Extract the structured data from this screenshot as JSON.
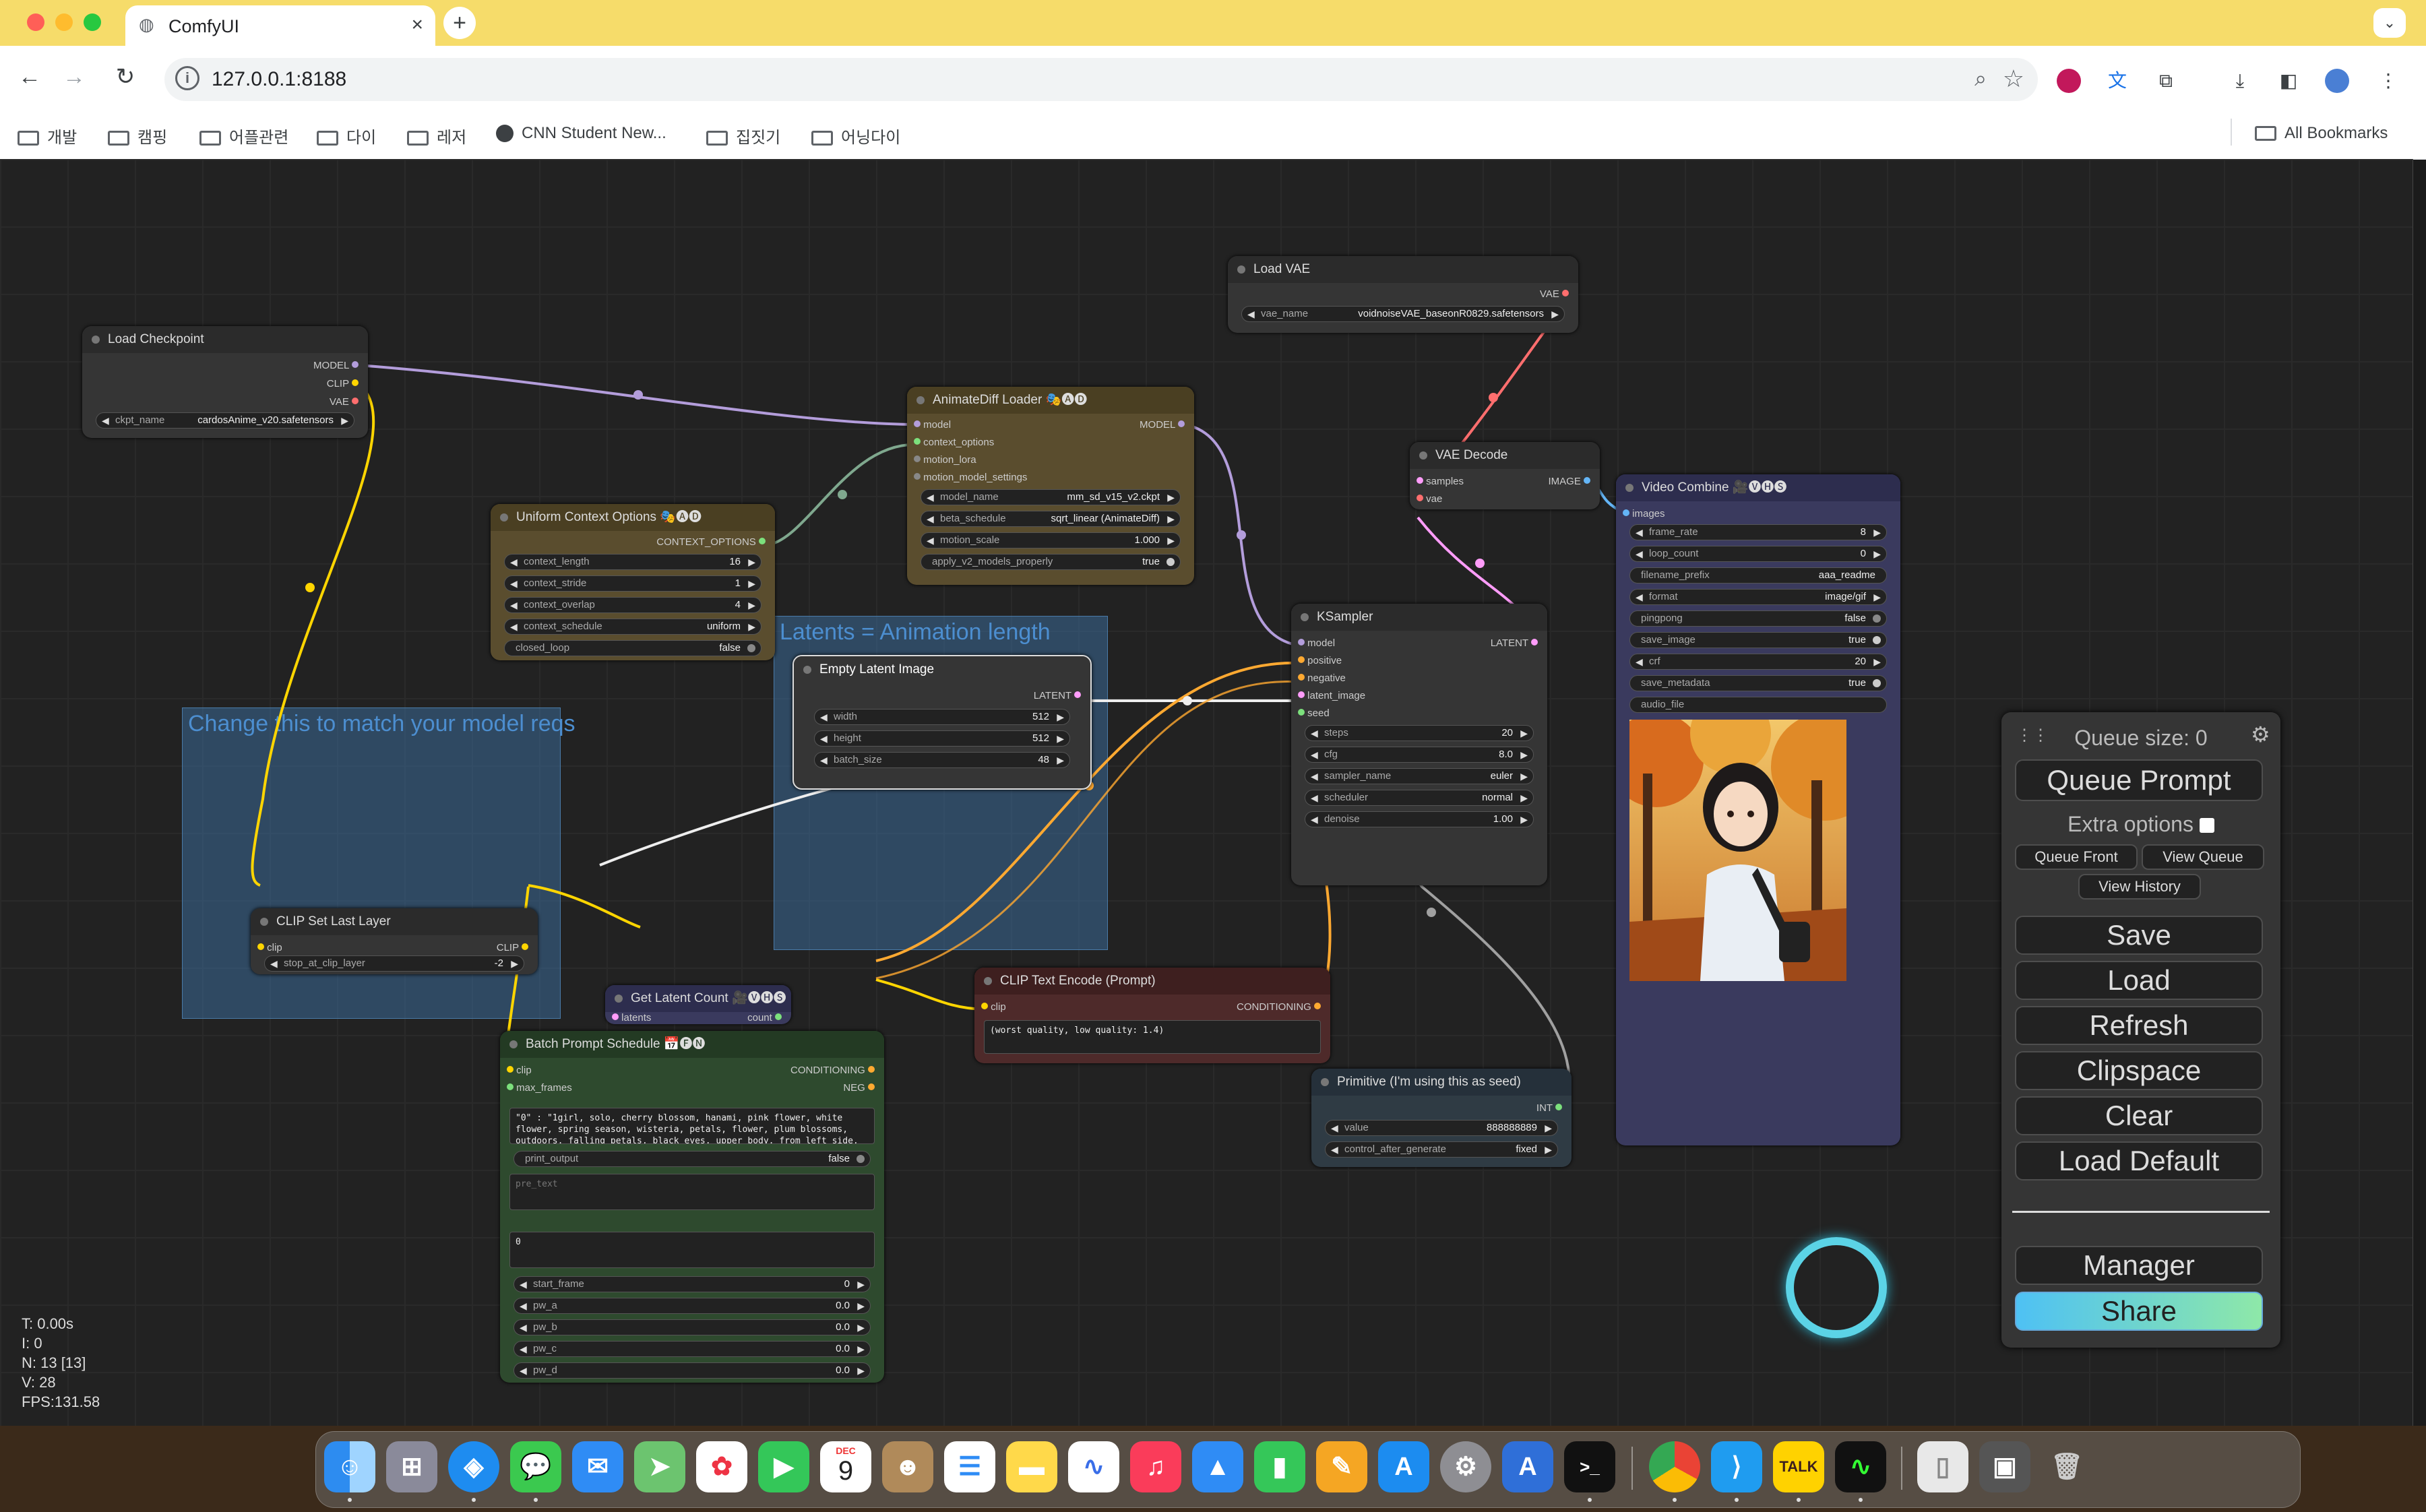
{
  "browser": {
    "tab_title": "ComfyUI",
    "url": "127.0.0.1:8188",
    "bookmarks": [
      "개발",
      "캠핑",
      "어플관련",
      "다이",
      "레저",
      "CNN Student New...",
      "집짓기",
      "어닝다이"
    ],
    "all_bookmarks": "All Bookmarks"
  },
  "nodes": {
    "load_checkpoint": {
      "title": "Load Checkpoint",
      "outputs": [
        "MODEL",
        "CLIP",
        "VAE"
      ],
      "ckpt_label": "ckpt_name",
      "ckpt_value": "cardosAnime_v20.safetensors"
    },
    "load_vae": {
      "title": "Load VAE",
      "output": "VAE",
      "vae_label": "vae_name",
      "vae_value": "voidnoiseVAE_baseonR0829.safetensors"
    },
    "animatediff": {
      "title": "AnimateDiff Loader 🎭🅐🅓",
      "output": "MODEL",
      "inputs": [
        "model",
        "context_options",
        "motion_lora",
        "motion_model_settings"
      ],
      "widgets": [
        {
          "label": "model_name",
          "value": "mm_sd_v15_v2.ckpt"
        },
        {
          "label": "beta_schedule",
          "value": "sqrt_linear (AnimateDiff)"
        },
        {
          "label": "motion_scale",
          "value": "1.000"
        }
      ],
      "toggle": {
        "label": "apply_v2_models_properly",
        "value": "true"
      }
    },
    "uniform_context": {
      "title": "Uniform Context Options 🎭🅐🅓",
      "output": "CONTEXT_OPTIONS",
      "widgets": [
        {
          "label": "context_length",
          "value": "16"
        },
        {
          "label": "context_stride",
          "value": "1"
        },
        {
          "label": "context_overlap",
          "value": "4"
        },
        {
          "label": "context_schedule",
          "value": "uniform"
        }
      ],
      "toggle": {
        "label": "closed_loop",
        "value": "false"
      }
    },
    "vae_decode": {
      "title": "VAE Decode",
      "inputs": [
        "samples",
        "vae"
      ],
      "output": "IMAGE"
    },
    "video_combine": {
      "title": "Video Combine 🎥🅥🅗🅢",
      "input": "images",
      "widgets": [
        {
          "label": "frame_rate",
          "value": "8"
        },
        {
          "label": "loop_count",
          "value": "0"
        },
        {
          "label": "filename_prefix",
          "value": "aaa_readme"
        },
        {
          "label": "format",
          "value": "image/gif"
        }
      ],
      "toggles": [
        {
          "label": "pingpong",
          "value": "false"
        },
        {
          "label": "save_image",
          "value": "true"
        }
      ],
      "crf": {
        "label": "crf",
        "value": "20"
      },
      "save_metadata": {
        "label": "save_metadata",
        "value": "true"
      },
      "audio": "audio_file"
    },
    "empty_latent": {
      "title": "Empty Latent Image",
      "output": "LATENT",
      "widgets": [
        {
          "label": "width",
          "value": "512"
        },
        {
          "label": "height",
          "value": "512"
        },
        {
          "label": "batch_size",
          "value": "48"
        }
      ]
    },
    "ksampler": {
      "title": "KSampler",
      "output": "LATENT",
      "inputs": [
        "model",
        "positive",
        "negative",
        "latent_image",
        "seed"
      ],
      "widgets": [
        {
          "label": "steps",
          "value": "20"
        },
        {
          "label": "cfg",
          "value": "8.0"
        },
        {
          "label": "sampler_name",
          "value": "euler"
        },
        {
          "label": "scheduler",
          "value": "normal"
        },
        {
          "label": "denoise",
          "value": "1.00"
        }
      ]
    },
    "clip_set_last": {
      "title": "CLIP Set Last Layer",
      "input": "clip",
      "output": "CLIP",
      "widget": {
        "label": "stop_at_clip_layer",
        "value": "-2"
      }
    },
    "get_latent_count": {
      "title": "Get Latent Count 🎥🅥🅗🅢",
      "input": "latents",
      "output": "count"
    },
    "batch_prompt": {
      "title": "Batch Prompt Schedule 📅🅕🅝",
      "inputs": [
        "clip",
        "max_frames"
      ],
      "outputs": [
        "CONDITIONING",
        "NEG"
      ],
      "text": "\"0\" : \"1girl, solo, cherry blossom, hanami, pink flower, white flower, spring season, wisteria, petals, flower, plum blossoms, outdoors, falling petals, black eyes, upper body, from left side,",
      "toggle": {
        "label": "print_output",
        "value": "false"
      },
      "pre_text": "pre_text",
      "app_text": "0",
      "widgets": [
        {
          "label": "start_frame",
          "value": "0"
        },
        {
          "label": "pw_a",
          "value": "0.0"
        },
        {
          "label": "pw_b",
          "value": "0.0"
        },
        {
          "label": "pw_c",
          "value": "0.0"
        },
        {
          "label": "pw_d",
          "value": "0.0"
        }
      ]
    },
    "clip_text": {
      "title": "CLIP Text Encode (Prompt)",
      "input": "clip",
      "output": "CONDITIONING",
      "text": "(worst quality, low quality: 1.4)"
    },
    "primitive": {
      "title": "Primitive (I'm using this as seed)",
      "output": "INT",
      "widgets": [
        {
          "label": "value",
          "value": "888888889"
        },
        {
          "label": "control_after_generate",
          "value": "fixed"
        }
      ]
    }
  },
  "groups": {
    "latents": "Latents = Animation length",
    "change": "Change this to match your model reqs"
  },
  "panel": {
    "queue_size": "Queue size: 0",
    "queue_prompt": "Queue Prompt",
    "extra_options": "Extra options",
    "queue_front": "Queue Front",
    "view_queue": "View Queue",
    "view_history": "View History",
    "save": "Save",
    "load": "Load",
    "refresh": "Refresh",
    "clipspace": "Clipspace",
    "clear": "Clear",
    "load_default": "Load Default",
    "manager": "Manager",
    "share": "Share"
  },
  "stats": [
    "T: 0.00s",
    "I: 0",
    "N: 13 [13]",
    "V: 28",
    "FPS:131.58"
  ],
  "dock": {
    "calendar_month": "DEC",
    "calendar_day": "9",
    "talk_label": "TALK",
    "apps": [
      "finder",
      "launchpad",
      "safari",
      "messages",
      "mail",
      "maps",
      "photos",
      "facetime",
      "calendar",
      "contacts",
      "reminders",
      "notes",
      "freeform",
      "music",
      "keynote",
      "numbers",
      "pages",
      "app-store",
      "system-settings",
      "instruments",
      "terminal",
      "chrome",
      "vscode",
      "kakaotalk",
      "activity-monitor",
      "document",
      "screenshot",
      "trash"
    ]
  },
  "colors": {
    "model_wire": "#b39ddb",
    "clip_wire": "#ffd500",
    "vae_wire": "#ff6e6e",
    "cond_wire": "#ffa931",
    "latent_wire": "#ff9cf9",
    "image_wire": "#64b5f6",
    "int_wire": "#7ce07c",
    "share_from": "#4ec1f4",
    "share_to": "#8ee8a8"
  }
}
